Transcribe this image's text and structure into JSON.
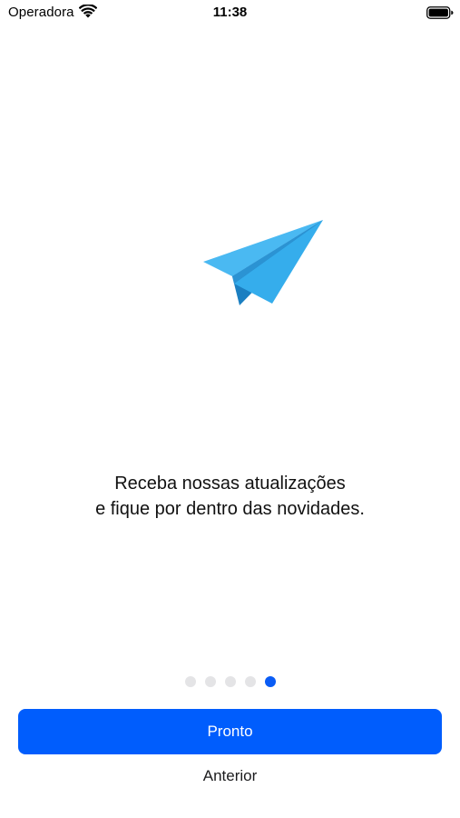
{
  "status_bar": {
    "carrier": "Operadora",
    "time": "11:38",
    "wifi_icon": "wifi-icon",
    "battery_icon": "battery-icon"
  },
  "illustration": {
    "icon": "paper-plane-icon",
    "colors": {
      "light": "#4ab9f2",
      "mid": "#2ea5e6",
      "dark": "#1b7fc1"
    }
  },
  "message": {
    "line1": "Receba nossas atualizações",
    "line2": "e fique por dentro das novidades."
  },
  "pagination": {
    "total": 5,
    "current": 5,
    "active_color": "#0a5cf5",
    "inactive_color": "#e4e4e6"
  },
  "actions": {
    "primary_label": "Pronto",
    "secondary_label": "Anterior",
    "primary_color": "#005dfd"
  }
}
